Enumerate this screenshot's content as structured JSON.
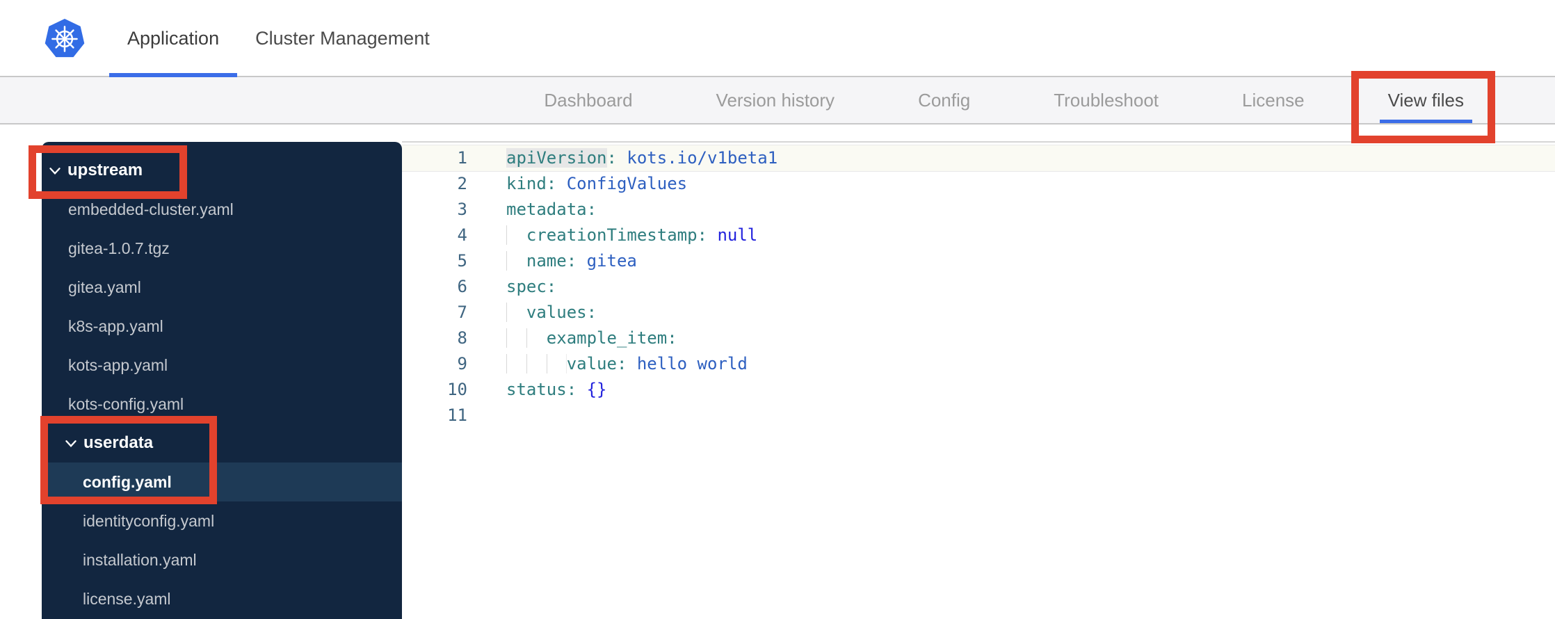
{
  "header": {
    "logo": "kubernetes-logo",
    "tabs": [
      {
        "label": "Application",
        "active": true
      },
      {
        "label": "Cluster Management",
        "active": false
      }
    ]
  },
  "nav": {
    "items": [
      "Dashboard",
      "Version history",
      "Config",
      "Troubleshoot",
      "License",
      "View files"
    ],
    "active": "View files"
  },
  "sidebar": {
    "items": [
      {
        "type": "folder",
        "label": "upstream",
        "level": 0,
        "expanded": true
      },
      {
        "type": "file",
        "label": "embedded-cluster.yaml",
        "level": 1
      },
      {
        "type": "file",
        "label": "gitea-1.0.7.tgz",
        "level": 1
      },
      {
        "type": "file",
        "label": "gitea.yaml",
        "level": 1
      },
      {
        "type": "file",
        "label": "k8s-app.yaml",
        "level": 1
      },
      {
        "type": "file",
        "label": "kots-app.yaml",
        "level": 1
      },
      {
        "type": "file",
        "label": "kots-config.yaml",
        "level": 1
      },
      {
        "type": "folder",
        "label": "userdata",
        "level": 1,
        "expanded": true
      },
      {
        "type": "file",
        "label": "config.yaml",
        "level": 2,
        "selected": true
      },
      {
        "type": "file",
        "label": "identityconfig.yaml",
        "level": 2
      },
      {
        "type": "file",
        "label": "installation.yaml",
        "level": 2
      },
      {
        "type": "file",
        "label": "license.yaml",
        "level": 2
      }
    ]
  },
  "editor": {
    "language": "yaml",
    "lines": [
      {
        "n": "1",
        "t": [
          [
            "khl",
            "apiVersion"
          ],
          [
            "p",
            ":"
          ],
          [
            "v",
            " kots.io/v1beta1"
          ]
        ]
      },
      {
        "n": "2",
        "t": [
          [
            "k",
            "kind"
          ],
          [
            "p",
            ":"
          ],
          [
            "v",
            " ConfigValues"
          ]
        ]
      },
      {
        "n": "3",
        "t": [
          [
            "k",
            "metadata"
          ],
          [
            "p",
            ":"
          ]
        ]
      },
      {
        "n": "4",
        "t": [
          [
            "i",
            "  "
          ],
          [
            "k",
            "creationTimestamp"
          ],
          [
            "p",
            ":"
          ],
          [
            "b",
            " null"
          ]
        ]
      },
      {
        "n": "5",
        "t": [
          [
            "i",
            "  "
          ],
          [
            "k",
            "name"
          ],
          [
            "p",
            ":"
          ],
          [
            "v",
            " gitea"
          ]
        ]
      },
      {
        "n": "6",
        "t": [
          [
            "k",
            "spec"
          ],
          [
            "p",
            ":"
          ]
        ]
      },
      {
        "n": "7",
        "t": [
          [
            "i",
            "  "
          ],
          [
            "k",
            "values"
          ],
          [
            "p",
            ":"
          ]
        ]
      },
      {
        "n": "8",
        "t": [
          [
            "i",
            "    "
          ],
          [
            "k",
            "example_item"
          ],
          [
            "p",
            ":"
          ]
        ]
      },
      {
        "n": "9",
        "t": [
          [
            "i",
            "      "
          ],
          [
            "k",
            "value"
          ],
          [
            "p",
            ":"
          ],
          [
            "v",
            " hello world"
          ]
        ]
      },
      {
        "n": "10",
        "t": [
          [
            "k",
            "status"
          ],
          [
            "p",
            ":"
          ],
          [
            "b",
            " {}"
          ]
        ]
      },
      {
        "n": "11",
        "t": []
      }
    ]
  },
  "annotations": {
    "color": "#e2422d",
    "boxes": [
      "upstream-folder",
      "userdata-and-config-yaml",
      "view-files-tab"
    ]
  },
  "colors": {
    "accent_blue": "#3b6de8",
    "sidebar_bg": "#122640",
    "sidebar_selected": "#1e3a56",
    "code_key": "#2e7d7e",
    "code_value": "#2d5fc0",
    "code_literal": "#2323dd",
    "line_number": "#3f6581",
    "annotation_red": "#e2422d"
  }
}
